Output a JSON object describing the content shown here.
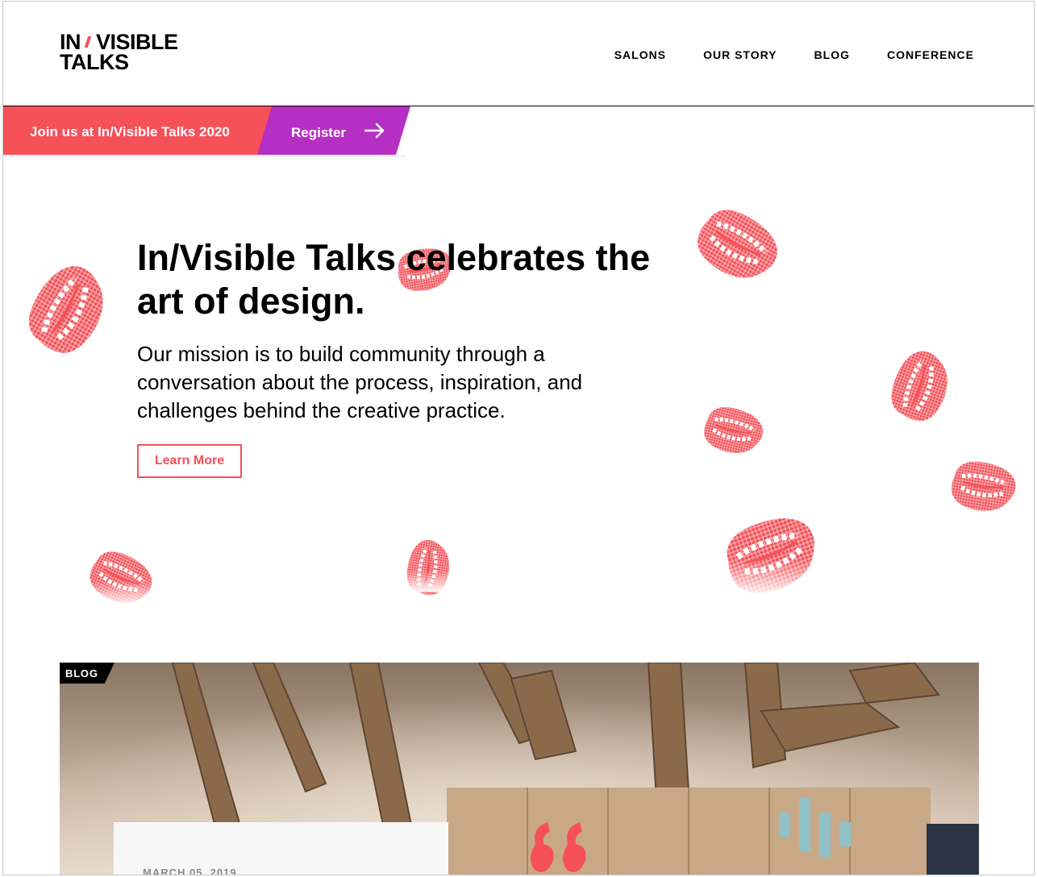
{
  "logo": {
    "line1_a": "IN",
    "line1_b": "VISIBLE",
    "line2": "TALKS"
  },
  "nav": {
    "items": [
      {
        "label": "SALONS"
      },
      {
        "label": "OUR STORY"
      },
      {
        "label": "BLOG"
      },
      {
        "label": "CONFERENCE"
      }
    ]
  },
  "banner": {
    "announcement": "Join us at In/Visible Talks 2020",
    "register_label": "Register",
    "colors": {
      "announcement_bg": "#f65058",
      "register_bg": "#b62fc4"
    }
  },
  "hero": {
    "title": "In/Visible Talks celebrates the art of design.",
    "text": "Our mission is to build community through a conversation about the process, inspiration, and challenges behind the creative practice.",
    "cta_label": "Learn More"
  },
  "blog_feature": {
    "tag": "BLOG",
    "date": "MARCH 05, 2019"
  },
  "colors": {
    "accent": "#f65058",
    "purple": "#b62fc4",
    "text": "#000000"
  },
  "icons": {
    "register_arrow": "arrow-right-icon",
    "decor": "chattering-teeth-icon"
  }
}
